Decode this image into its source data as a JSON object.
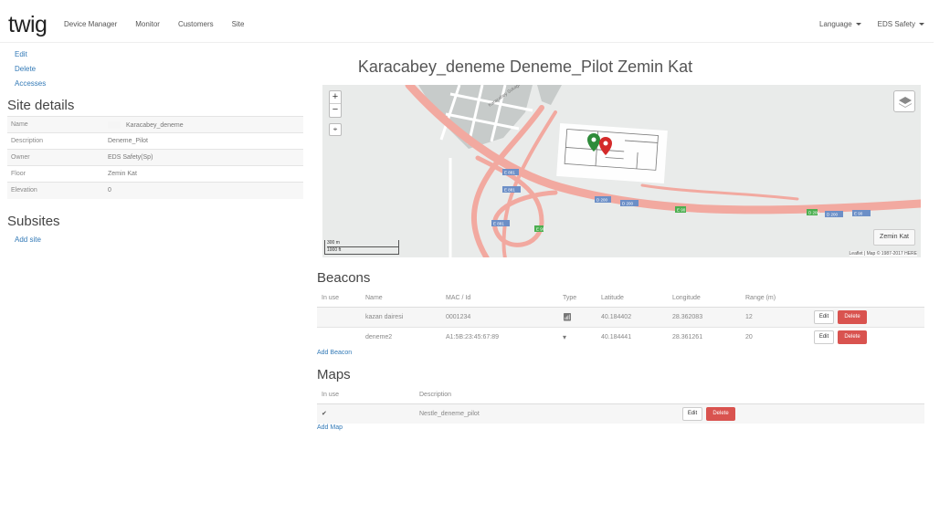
{
  "navbar": {
    "brand": "twig",
    "items": [
      "Device Manager",
      "Monitor",
      "Customers",
      "Site"
    ],
    "language": "Language",
    "account": "EDS Safety"
  },
  "actions": {
    "edit": "Edit",
    "delete": "Delete",
    "accesses": "Accesses"
  },
  "site_details": {
    "heading": "Site details",
    "rows": [
      {
        "label": "Name",
        "value": "Karacabey_deneme"
      },
      {
        "label": "Description",
        "value": "Deneme_Pilot"
      },
      {
        "label": "Owner",
        "value": "EDS Safety(Sp)"
      },
      {
        "label": "Floor",
        "value": "Zemin Kat"
      },
      {
        "label": "Elevation",
        "value": "0"
      }
    ]
  },
  "subsites": {
    "heading": "Subsites",
    "add_label": "Add site"
  },
  "page_title": "Karacabey_deneme Deneme_Pilot Zemin Kat",
  "map": {
    "zoom_in": "+",
    "zoom_out": "−",
    "locate": "⌖",
    "floor_button": "Zemin Kat",
    "scale_metric": "300 m",
    "scale_imperial": "1000 ft",
    "attribution": "Leaflet | Map © 1987-2017 HERE",
    "street_label": "Karacabey Sokağı",
    "road_labels": [
      "E 881",
      "E 881",
      "E 881",
      "D 200",
      "D 200",
      "E 90",
      "E 90",
      "D 200",
      "D 200",
      "E 90"
    ],
    "colors": {
      "road": "#f2a9a0",
      "background": "#e9ebea",
      "building": "#c7cbca",
      "marker_green": "#2e8b3a",
      "marker_red": "#d42a2a",
      "shield": "#6c8fc7"
    }
  },
  "beacons": {
    "heading": "Beacons",
    "columns": [
      "In use",
      "Name",
      "MAC / Id",
      "Type",
      "Latitude",
      "Longitude",
      "Range (m)"
    ],
    "rows": [
      {
        "name": "kazan dairesi",
        "mac": "0001234",
        "type_icon": "antenna-icon",
        "lat": "40.184402",
        "lng": "28.362083",
        "range": "12"
      },
      {
        "name": "deneme2",
        "mac": "A1:5B:23:45:67:89",
        "type_icon": "wifi-icon",
        "lat": "40.184441",
        "lng": "28.361261",
        "range": "20"
      }
    ],
    "edit_label": "Edit",
    "delete_label": "Delete",
    "add_label": "Add Beacon"
  },
  "maps": {
    "heading": "Maps",
    "columns": [
      "In use",
      "Description"
    ],
    "rows": [
      {
        "in_use": "✔",
        "description": "Nestle_deneme_pilot"
      }
    ],
    "edit_label": "Edit",
    "delete_label": "Delete",
    "add_label": "Add Map"
  }
}
